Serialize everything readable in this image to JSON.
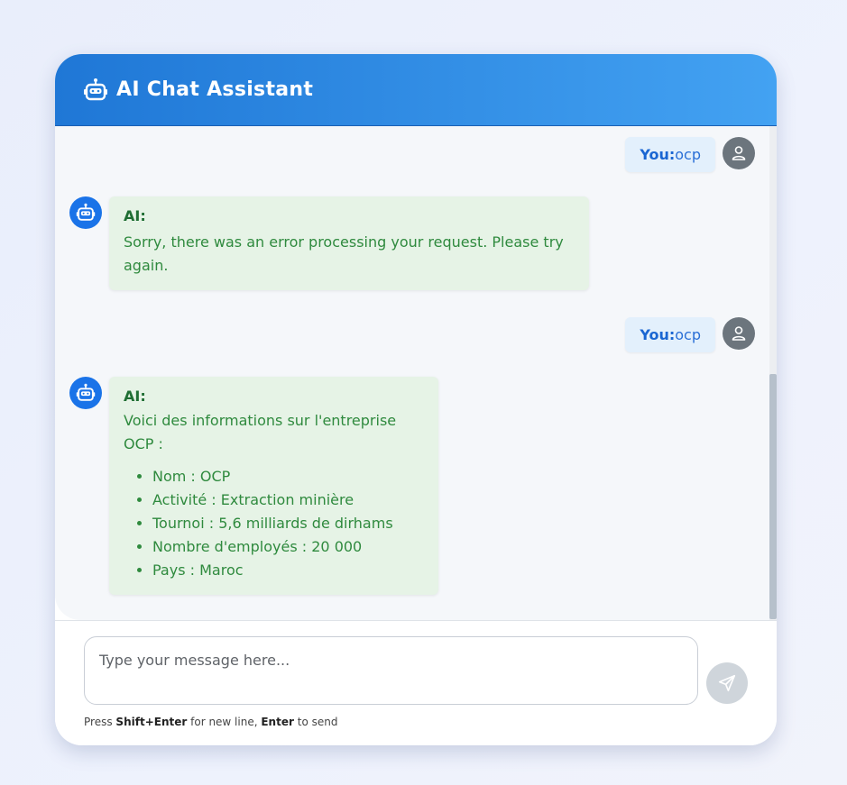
{
  "header": {
    "title": "AI Chat Assistant",
    "icon": "robot-icon"
  },
  "messages": [
    {
      "sender": "user",
      "label": "You:",
      "text": "ocp"
    },
    {
      "sender": "ai",
      "label": "AI:",
      "text": "Sorry, there was an error processing your request. Please try again."
    },
    {
      "sender": "user",
      "label": "You:",
      "text": "ocp"
    },
    {
      "sender": "ai",
      "label": "AI:",
      "text": "Voici des informations sur l'entreprise OCP :",
      "list": [
        "Nom : OCP",
        "Activité : Extraction minière",
        "Tournoi : 5,6 milliards de dirhams",
        "Nombre d'employés : 20 000",
        "Pays : Maroc"
      ]
    }
  ],
  "input": {
    "placeholder": "Type your message here...",
    "value": ""
  },
  "hint": {
    "prefix": "Press",
    "key1": "Shift",
    "plus": "+",
    "key2": "Enter",
    "mid": "for new line,",
    "key3": "Enter",
    "suffix": "to send"
  },
  "colors": {
    "header_start": "#1f77d6",
    "header_end": "#43a2f2",
    "ai_bubble": "#e6f3e6",
    "ai_text": "#2f8a3e",
    "user_bubble": "#e3f0fc",
    "user_text": "#1a66d2",
    "send_button": "#cfd5db"
  }
}
